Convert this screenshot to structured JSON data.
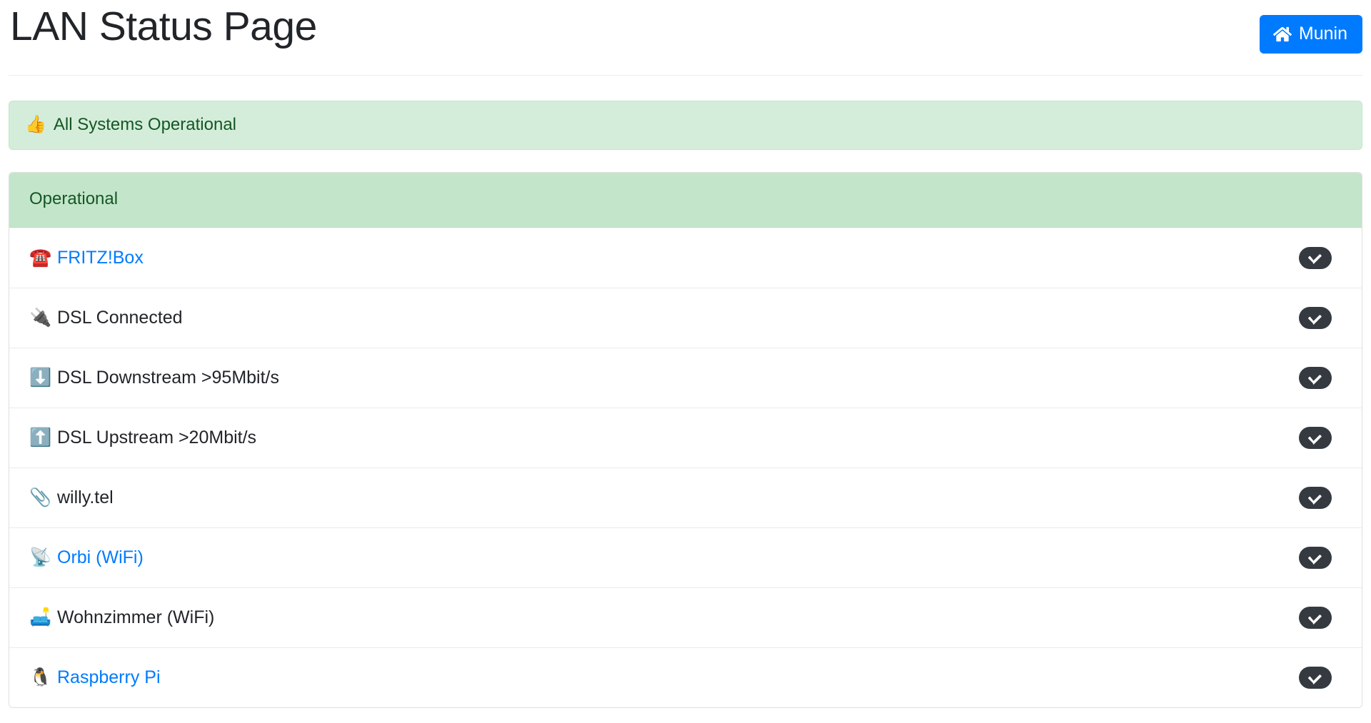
{
  "header": {
    "title": "LAN Status Page",
    "munin_button": {
      "label": "Munin",
      "icon": "home-icon",
      "color": "#007bff"
    }
  },
  "alert": {
    "icon": "thumbs-up-icon",
    "emoji": "👍",
    "text": "All Systems Operational",
    "background": "#d4edda",
    "text_color": "#155724"
  },
  "card": {
    "header": {
      "label": "Operational",
      "background": "#c3e6cb",
      "text_color": "#155724"
    },
    "status_badge": {
      "icon": "check-circle-icon",
      "background": "#343a40",
      "mark_color": "#ffffff"
    },
    "items": [
      {
        "emoji": "☎️",
        "icon": "telephone-icon",
        "label": "FRITZ!Box",
        "is_link": true,
        "status": "ok"
      },
      {
        "emoji": "🔌",
        "icon": "electric-plug-icon",
        "label": "DSL Connected",
        "is_link": false,
        "status": "ok"
      },
      {
        "emoji": "⬇️",
        "icon": "arrow-down-icon",
        "label": "DSL Downstream >95Mbit/s",
        "is_link": false,
        "status": "ok"
      },
      {
        "emoji": "⬆️",
        "icon": "arrow-up-icon",
        "label": "DSL Upstream >20Mbit/s",
        "is_link": false,
        "status": "ok"
      },
      {
        "emoji": "📎",
        "icon": "paperclip-icon",
        "label": "willy.tel",
        "is_link": false,
        "status": "ok"
      },
      {
        "emoji": "📡",
        "icon": "satellite-antenna-icon",
        "label": "Orbi (WiFi)",
        "is_link": true,
        "status": "ok"
      },
      {
        "emoji": "🛋️",
        "icon": "couch-icon",
        "label": "Wohnzimmer (WiFi)",
        "is_link": false,
        "status": "ok"
      },
      {
        "emoji": "🐧",
        "icon": "penguin-icon",
        "label": "Raspberry Pi",
        "is_link": true,
        "status": "ok"
      }
    ]
  }
}
